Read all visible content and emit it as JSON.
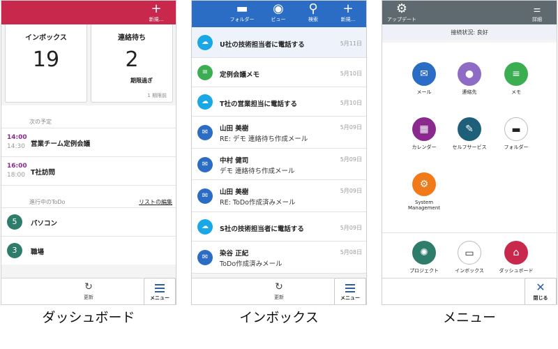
{
  "dashboard": {
    "header": {
      "new_icon": "plus-icon",
      "new_label": "新規..."
    },
    "cards": [
      {
        "title": "インボックス",
        "count": "19",
        "sub": "",
        "foot": ""
      },
      {
        "title": "連絡待ち",
        "count": "2",
        "sub": "期限過ぎ",
        "foot": "1 期限前"
      }
    ],
    "schedule": {
      "heading": "次の予定",
      "events": [
        {
          "start": "14:00",
          "end": "14:30",
          "title": "営業チーム定例会議"
        },
        {
          "start": "16:00",
          "end": "18:00",
          "title": "T社訪問"
        }
      ]
    },
    "todo": {
      "heading": "進行中のToDo",
      "edit_link": "リストの編集",
      "items": [
        {
          "count": "5",
          "title": "パソコン"
        },
        {
          "count": "3",
          "title": "職場"
        }
      ]
    },
    "bottom": {
      "refresh_label": "更新",
      "menu_label": "メニュー"
    },
    "caption": "ダッシュボード"
  },
  "inbox": {
    "header": [
      {
        "icon": "folder-icon",
        "glyph": "▬",
        "label": "フォルダー"
      },
      {
        "icon": "eye-icon",
        "glyph": "◉",
        "label": "ビュー"
      },
      {
        "icon": "search-icon",
        "glyph": "⚲",
        "label": "検索"
      },
      {
        "icon": "plus-icon",
        "glyph": "+",
        "label": "新規..."
      }
    ],
    "items": [
      {
        "type": "cloud",
        "title": "U社の技術担当者に電話する",
        "sub": "",
        "date": "5月11日"
      },
      {
        "type": "memo",
        "title": "定例会議メモ",
        "sub": "",
        "date": "5月10日"
      },
      {
        "type": "cloud",
        "title": "T社の営業担当に電話する",
        "sub": "",
        "date": "5月10日"
      },
      {
        "type": "mail",
        "title": "山田 美樹",
        "sub": "RE: デモ 連絡待ち作成メール",
        "date": "5月09日"
      },
      {
        "type": "mail",
        "title": "中村 健司",
        "sub": "デモ 連絡待ち作成メール",
        "date": "5月09日"
      },
      {
        "type": "mail",
        "title": "山田 美樹",
        "sub": "RE: ToDo作成済みメール",
        "date": "5月09日"
      },
      {
        "type": "cloud",
        "title": "S社の技術担当者に電話する",
        "sub": "",
        "date": "5月09日"
      },
      {
        "type": "mail",
        "title": "染谷 正紀",
        "sub": "ToDo作成済みメール",
        "date": "5月08日"
      }
    ],
    "bottom": {
      "refresh_label": "更新",
      "menu_label": "メニュー"
    },
    "caption": "インボックス"
  },
  "menu": {
    "header": {
      "update_label": "アップデート",
      "detail_label": "詳細"
    },
    "status": "接続状況: 良好",
    "tiles": [
      {
        "icon": "mail-icon",
        "glyph": "✉",
        "label": "メール",
        "color": "#2b6cc4"
      },
      {
        "icon": "contact-icon",
        "glyph": "👤",
        "label": "連絡先",
        "color": "#8e6bc4"
      },
      {
        "icon": "memo-icon",
        "glyph": "≡",
        "label": "メモ",
        "color": "#3cae52"
      },
      {
        "icon": "calendar-icon",
        "glyph": "▦",
        "label": "カレンダー",
        "color": "#8a2a8f"
      },
      {
        "icon": "wrench-icon",
        "glyph": "✎",
        "label": "セルフサービス",
        "color": "#1e5f7a"
      },
      {
        "icon": "folder-icon",
        "glyph": "▬",
        "label": "フォルダー",
        "color": "#ffffff"
      },
      {
        "icon": "gear-icon",
        "glyph": "⚙",
        "label": "System Management",
        "color": "#f07a1a"
      },
      {
        "icon": "bulb-icon",
        "glyph": "💡",
        "label": "プロジェクト",
        "color": "#2e7d6a"
      },
      {
        "icon": "inbox-tray-icon",
        "glyph": "▭",
        "label": "インボックス",
        "color": "#ffffff"
      },
      {
        "icon": "home-icon",
        "glyph": "⌂",
        "label": "ダッシュボード",
        "color": "#c8284b"
      }
    ],
    "close_label": "閉じる",
    "caption": "メニュー"
  }
}
